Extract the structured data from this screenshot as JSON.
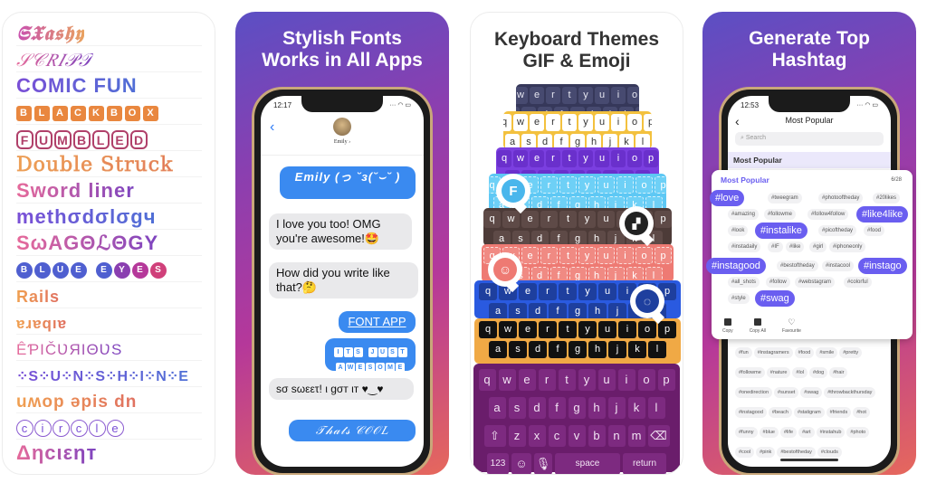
{
  "panel1": {
    "fonts": [
      {
        "name": "flashy",
        "text": "𝕾𝖃𝖆𝖘𝖍𝖞",
        "display": "SXashy"
      },
      {
        "name": "script",
        "text": "𝒮𝒞𝑅𝐼𝒫𝒯"
      },
      {
        "name": "comic-fun",
        "text": "COMIC FUN"
      },
      {
        "name": "blackbox",
        "letters": [
          "B",
          "L",
          "A",
          "C",
          "K",
          "B",
          "O",
          "X"
        ]
      },
      {
        "name": "fumbled",
        "letters": [
          "F",
          "U",
          "M",
          "B",
          "L",
          "E",
          "D"
        ]
      },
      {
        "name": "double-struck",
        "text": "Double Struck"
      },
      {
        "name": "sword-liner",
        "text": "Sword liner"
      },
      {
        "name": "methodology",
        "text": "methσdσlσgч"
      },
      {
        "name": "swagology",
        "text": "SωAGΘℒΘGY"
      },
      {
        "name": "blue-eyes",
        "letters": [
          "B",
          "L",
          "U",
          "E",
          " ",
          "E",
          "Y",
          "E",
          "S"
        ]
      },
      {
        "name": "rails",
        "text": "Rails"
      },
      {
        "name": "upside-arabic",
        "text": "ɐɹɐqıɐ"
      },
      {
        "name": "epicurious",
        "text": "ÊƤIČƲЯIΘƲS"
      },
      {
        "name": "sunshine",
        "text": "⁘S⁘U⁘N⁘S⁘H⁘I⁘N⁘E"
      },
      {
        "name": "upside-down",
        "text": "uʍop əpis dn"
      },
      {
        "name": "circle",
        "letters": [
          "c",
          "i",
          "r",
          "c",
          "l",
          "e"
        ]
      },
      {
        "name": "ancient",
        "text": "Δηcιεηт"
      }
    ]
  },
  "panel2": {
    "headline_line1": "Stylish Fonts",
    "headline_line2": "Works in All Apps",
    "status_time": "12:17",
    "contact_name": "Emily ›",
    "messages": [
      {
        "side": "out",
        "text": "Emily (っ ˘з(˘⌣˘ )"
      },
      {
        "side": "in",
        "text": "I love you too! OMG you're awesome!🤩"
      },
      {
        "side": "in",
        "text": "How did you write like that?🤔"
      },
      {
        "side": "out",
        "text": "FONT APP"
      },
      {
        "side": "out",
        "letters_row1": [
          "I",
          "T",
          "S",
          " ",
          "J",
          "U",
          "S",
          "T"
        ],
        "letters_row2": [
          "A",
          "W",
          "E",
          "S",
          "O",
          "M",
          "E"
        ]
      },
      {
        "side": "in",
        "text": "sσ sωεετ! ι gσт ιт ♥‿♥"
      },
      {
        "side": "out",
        "text": "𝒯𝒽𝒶𝓉𝓈 𝒞𝒪𝒪𝐿"
      }
    ]
  },
  "panel3": {
    "headline_line1": "Keyboard Themes",
    "headline_line2": "GIF & Emoji",
    "row1": [
      "q",
      "w",
      "e",
      "r",
      "t",
      "y",
      "u",
      "i",
      "o",
      "p"
    ],
    "row2": [
      "a",
      "s",
      "d",
      "f",
      "g",
      "h",
      "j",
      "k",
      "l"
    ],
    "row3": [
      "z",
      "x",
      "c",
      "v",
      "b",
      "n",
      "m"
    ],
    "themes": [
      {
        "name": "navy",
        "bg": "#36385a",
        "key": "#474a70",
        "fg": "#e5e5f0"
      },
      {
        "name": "yellow",
        "bg": "#f3c13e",
        "key": "#ffffff",
        "fg": "#333333"
      },
      {
        "name": "purple",
        "bg": "#7b3fe0",
        "key": "#6a30cc",
        "fg": "#ffffff"
      },
      {
        "name": "sky",
        "bg": "#5ec8f4",
        "key": "#6ed0f6",
        "fg": "#ffffff"
      },
      {
        "name": "brown",
        "bg": "#4d3b38",
        "key": "#5e4a47",
        "fg": "#ffffff"
      },
      {
        "name": "coral",
        "bg": "#ee7a73",
        "key": "#f08a83",
        "fg": "#ffffff"
      },
      {
        "name": "blue",
        "bg": "#2a5ae0",
        "key": "#1e3f9e",
        "fg": "#ffffff"
      },
      {
        "name": "orange-black",
        "bg": "#f0a945",
        "key": "#111111",
        "fg": "#ffffff"
      }
    ],
    "bottom_row": {
      "numbers": "123",
      "space": "space",
      "return": "return"
    },
    "icons": {
      "font": "F"
    }
  },
  "panel4": {
    "headline_line1": "Generate Top",
    "headline_line2": "Hashtag",
    "status_time": "12:53",
    "nav_title": "Most Popular",
    "search_placeholder": "Search",
    "section_title": "Most Popular",
    "card": {
      "title": "Most Popular",
      "count": "6/28",
      "tags": [
        {
          "text": "#love",
          "big": true
        },
        {
          "text": "#tweegram"
        },
        {
          "text": "#photooftheday"
        },
        {
          "text": "#20likes"
        },
        {
          "text": "#amazing"
        },
        {
          "text": "#followme"
        },
        {
          "text": "#follow4follow"
        },
        {
          "text": "#like4like",
          "big": true
        },
        {
          "text": "#look"
        },
        {
          "text": "#instalike",
          "big": true
        },
        {
          "text": "#picoftheday"
        },
        {
          "text": "#food"
        },
        {
          "text": "#instadaily"
        },
        {
          "text": "#IF"
        },
        {
          "text": "#like"
        },
        {
          "text": "#girl"
        },
        {
          "text": "#iphoneonly"
        },
        {
          "text": "#instagood",
          "big": true
        },
        {
          "text": "#bestoftheday"
        },
        {
          "text": "#instacool"
        },
        {
          "text": "#instago",
          "big": true
        },
        {
          "text": "#all_shots"
        },
        {
          "text": "#follow"
        },
        {
          "text": "#webstagram"
        },
        {
          "text": "#colorful"
        },
        {
          "text": "#style"
        },
        {
          "text": "#swag",
          "big": true
        }
      ],
      "actions": [
        "Copy",
        "Copy All",
        "Favourite"
      ]
    },
    "more_tags": [
      "#fun",
      "#instagramers",
      "#food",
      "#smile",
      "#pretty",
      "#followme",
      "#nature",
      "#lol",
      "#dog",
      "#hair",
      "#onedirection",
      "#sunset",
      "#swag",
      "#throwbackthursday",
      "#instagood",
      "#beach",
      "#statigram",
      "#friends",
      "#hot",
      "#funny",
      "#blue",
      "#life",
      "#art",
      "#instahub",
      "#photo",
      "#cool",
      "#pink",
      "#bestoftheday",
      "#clouds"
    ]
  },
  "colors": {
    "accent": "#6a5ef0",
    "imessage_blue": "#3a8af0",
    "keyboard_purple": "#6a1d6b"
  }
}
